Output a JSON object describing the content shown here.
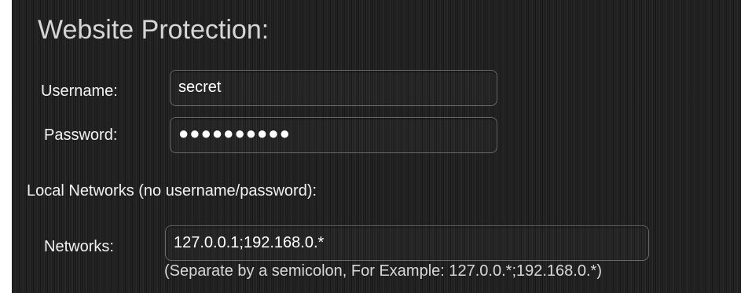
{
  "section": {
    "title": "Website Protection:"
  },
  "credentials": {
    "username_label": "Username:",
    "username_value": "secret",
    "password_label": "Password:",
    "password_value": "●●●●●●●●●●"
  },
  "local_networks": {
    "heading": "Local Networks (no username/password):",
    "networks_label": "Networks:",
    "networks_value": "127.0.0.1;192.168.0.*",
    "hint": "(Separate by a semicolon, For Example: 127.0.0.*;192.168.0.*)"
  }
}
